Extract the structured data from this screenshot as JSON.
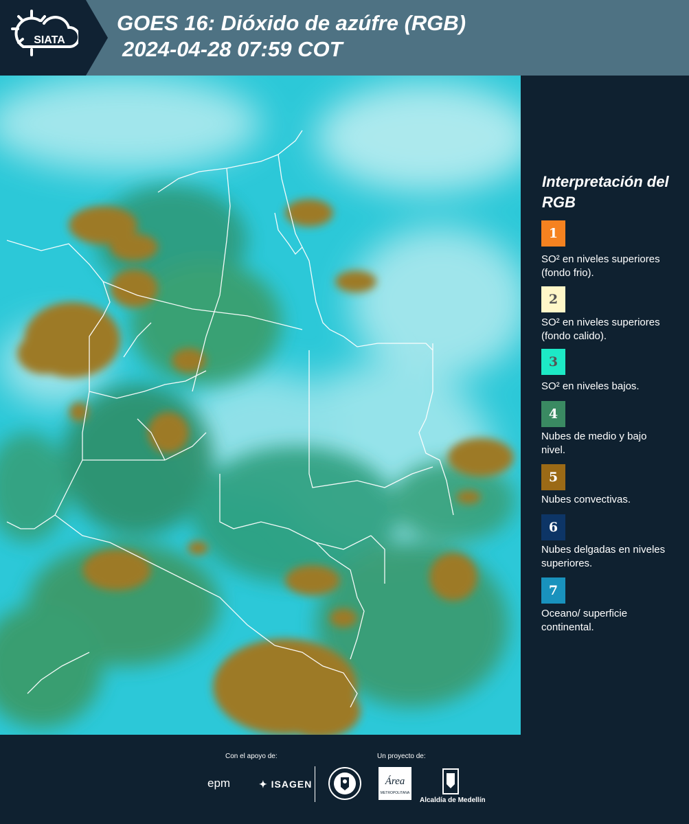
{
  "header": {
    "logo_text": "SIATA",
    "title": "GOES 16: Dióxido de azúfre (RGB)",
    "subtitle": "2024-04-28 07:59 COT"
  },
  "legend": {
    "title": "Interpretación del RGB",
    "items": [
      {
        "number": "1",
        "color": "#f58220",
        "text_color": "#ffffff",
        "label": "SO² en niveles superiores (fondo frio)."
      },
      {
        "number": "2",
        "color": "#fff7c8",
        "text_color": "#555555",
        "label": "SO² en niveles superiores (fondo calido)."
      },
      {
        "number": "3",
        "color": "#1de9c6",
        "text_color": "#555555",
        "label": "SO² en niveles bajos."
      },
      {
        "number": "4",
        "color": "#3a8a62",
        "text_color": "#ffffff",
        "label": "Nubes de medio y bajo nivel."
      },
      {
        "number": "5",
        "color": "#9b6a16",
        "text_color": "#ffffff",
        "label": "Nubes convectivas."
      },
      {
        "number": "6",
        "color": "#0d3566",
        "text_color": "#ffffff",
        "label": "Nubes delgadas en niveles superiores."
      },
      {
        "number": "7",
        "color": "#1992bd",
        "text_color": "#ffffff",
        "label": "Oceano/ superficie continental."
      }
    ]
  },
  "footer": {
    "support_label": "Con el apoyo de:",
    "project_label": "Un proyecto de:",
    "sponsors": [
      "epm",
      "ISAGEN"
    ],
    "partners": [
      "Área Metropolitana Valle de Aburrá",
      "Alcaldía de Medellín"
    ],
    "alcaldia_label": "Alcaldía de Medellín",
    "area_label": "Área",
    "area_sub": "METROPOLITANA"
  }
}
